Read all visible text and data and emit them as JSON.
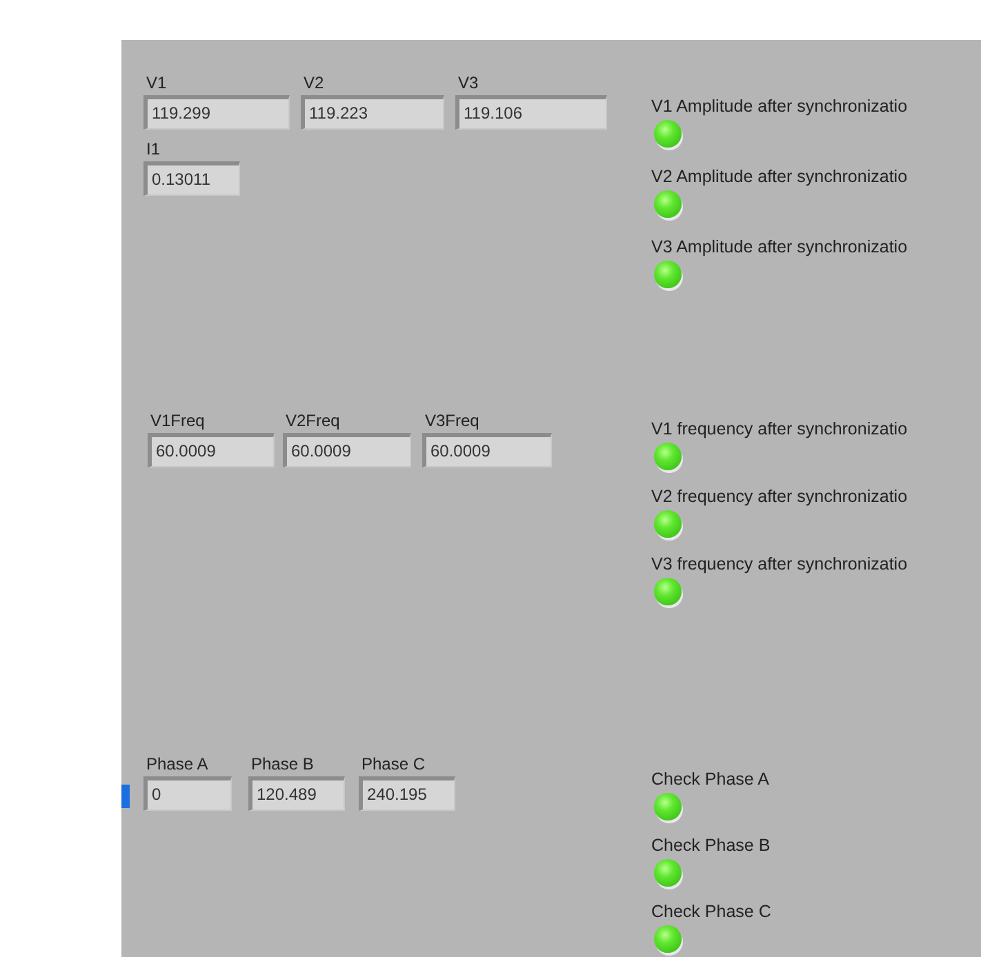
{
  "amplitude_readings": [
    {
      "label": "V1",
      "value": "119.299"
    },
    {
      "label": "V2",
      "value": "119.223"
    },
    {
      "label": "V3",
      "value": "119.106"
    }
  ],
  "current_readings": [
    {
      "label": "I1",
      "value": "0.13011"
    }
  ],
  "amplitude_checks": [
    {
      "label": "V1 Amplitude after synchronizatio",
      "on": true
    },
    {
      "label": "V2 Amplitude after synchronizatio",
      "on": true
    },
    {
      "label": "V3 Amplitude after synchronizatio",
      "on": true
    }
  ],
  "frequency_readings": [
    {
      "label": "V1Freq",
      "value": "60.0009"
    },
    {
      "label": "V2Freq",
      "value": "60.0009"
    },
    {
      "label": "V3Freq",
      "value": "60.0009"
    }
  ],
  "frequency_checks": [
    {
      "label": "V1 frequency after synchronizatio",
      "on": true
    },
    {
      "label": "V2 frequency after synchronizatio",
      "on": true
    },
    {
      "label": "V3 frequency after synchronizatio",
      "on": true
    }
  ],
  "phase_readings": [
    {
      "label": "Phase A",
      "value": "0",
      "focused": true
    },
    {
      "label": "Phase B",
      "value": "120.489",
      "focused": false
    },
    {
      "label": "Phase C",
      "value": "240.195",
      "focused": false
    }
  ],
  "phase_checks": [
    {
      "label": "Check Phase A",
      "on": true
    },
    {
      "label": "Check Phase B",
      "on": true
    },
    {
      "label": "Check Phase C",
      "on": true
    }
  ]
}
